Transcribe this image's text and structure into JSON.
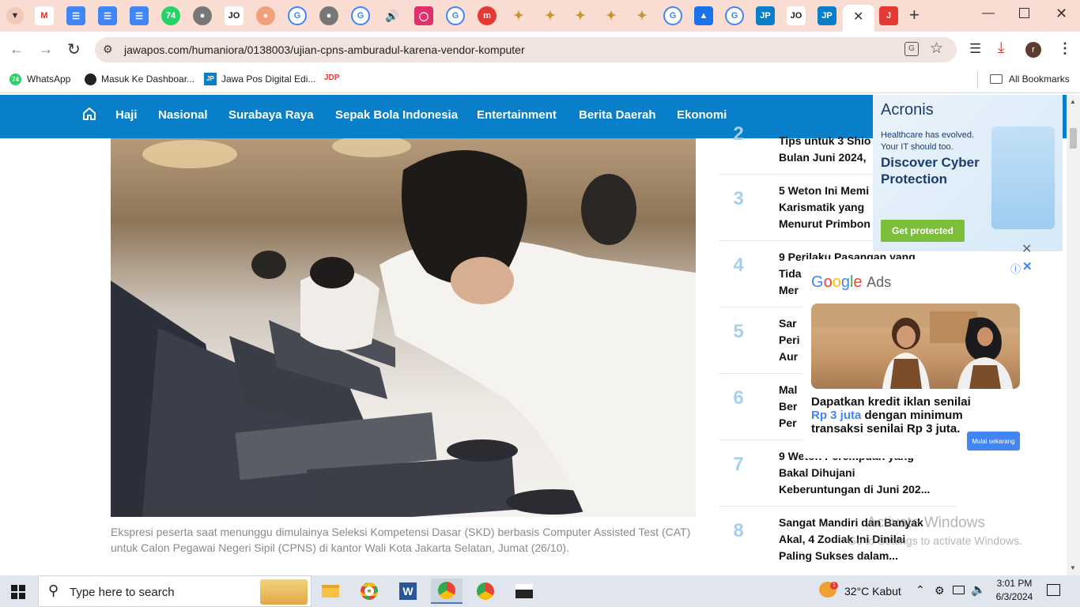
{
  "browser": {
    "url": "jawapos.com/humaniora/0138003/ujian-cpns-amburadul-karena-vendor-komputer",
    "bookmarks": [
      {
        "label": "WhatsApp"
      },
      {
        "label": "Masuk Ke Dashboar..."
      },
      {
        "label": "Jawa Pos Digital Edi..."
      }
    ],
    "all_bookmarks": "All Bookmarks",
    "profile_initial": "r",
    "tab_labels": [
      "JP",
      "JP"
    ]
  },
  "site": {
    "nav": [
      "Haji",
      "Nasional",
      "Surabaya Raya",
      "Sepak Bola Indonesia",
      "Entertainment",
      "Berita Daerah",
      "Ekonomi"
    ]
  },
  "article": {
    "caption": "Ekspresi peserta saat menunggu dimulainya Seleksi Kompetensi Dasar (SKD) berbasis Computer Assisted Test (CAT) untuk Calon Pegawai Negeri Sipil (CPNS) di kantor Wali Kota Jakarta Selatan, Jumat (26/10)."
  },
  "sidebar": {
    "items": [
      {
        "rank": "2",
        "lines": [
          "Tips untuk 3 Shio",
          "Bulan Juni 2024,"
        ]
      },
      {
        "rank": "3",
        "lines": [
          "5 Weton Ini Memi",
          "Karismatik yang",
          "Menurut Primbon"
        ]
      },
      {
        "rank": "4",
        "lines": [
          "9 Perilaku Pasangan yang",
          "Tida",
          "Mer"
        ]
      },
      {
        "rank": "5",
        "lines": [
          "Sar",
          "Peri",
          "Aur"
        ]
      },
      {
        "rank": "6",
        "lines": [
          "Mal",
          "Ber",
          "Per"
        ]
      },
      {
        "rank": "7",
        "lines": [
          "9 Weton Perempuan yang",
          "Bakal Dihujani",
          "Keberuntungan di Juni 202..."
        ]
      },
      {
        "rank": "8",
        "lines": [
          "Sangat Mandiri dan Banyak",
          "Akal, 4 Zodiak Ini Dinilai",
          "Paling Sukses dalam..."
        ]
      }
    ]
  },
  "ad_acronis": {
    "brand": "Acronis",
    "line1": "Healthcare has evolved.",
    "line2": "Your IT should too.",
    "headline1": "Discover Cyber",
    "headline2": "Protection",
    "cta": "Get protected"
  },
  "ad_google": {
    "brand_parts": [
      "G",
      "o",
      "o",
      "g",
      "l",
      "e"
    ],
    "brand_suffix": "Ads",
    "text_line1": "Dapatkan kredit iklan senilai",
    "text_highlight": "Rp 3 juta",
    "text_line2": " dengan minimum",
    "text_line3": "transaksi senilai Rp 3 juta.",
    "cta": "Mulai sekarang"
  },
  "watermark": {
    "line1": "Activate Windows",
    "line2": "Go to Settings to activate Windows."
  },
  "taskbar": {
    "search_placeholder": "Type here to search",
    "weather": "32°C  Kabut",
    "time": "3:01 PM",
    "date": "6/3/2024",
    "badge": "1"
  },
  "colors": {
    "nav_bg": "#0a7fc9",
    "chrome_bg": "#f9dcd2",
    "rank": "#a7d0ee"
  }
}
